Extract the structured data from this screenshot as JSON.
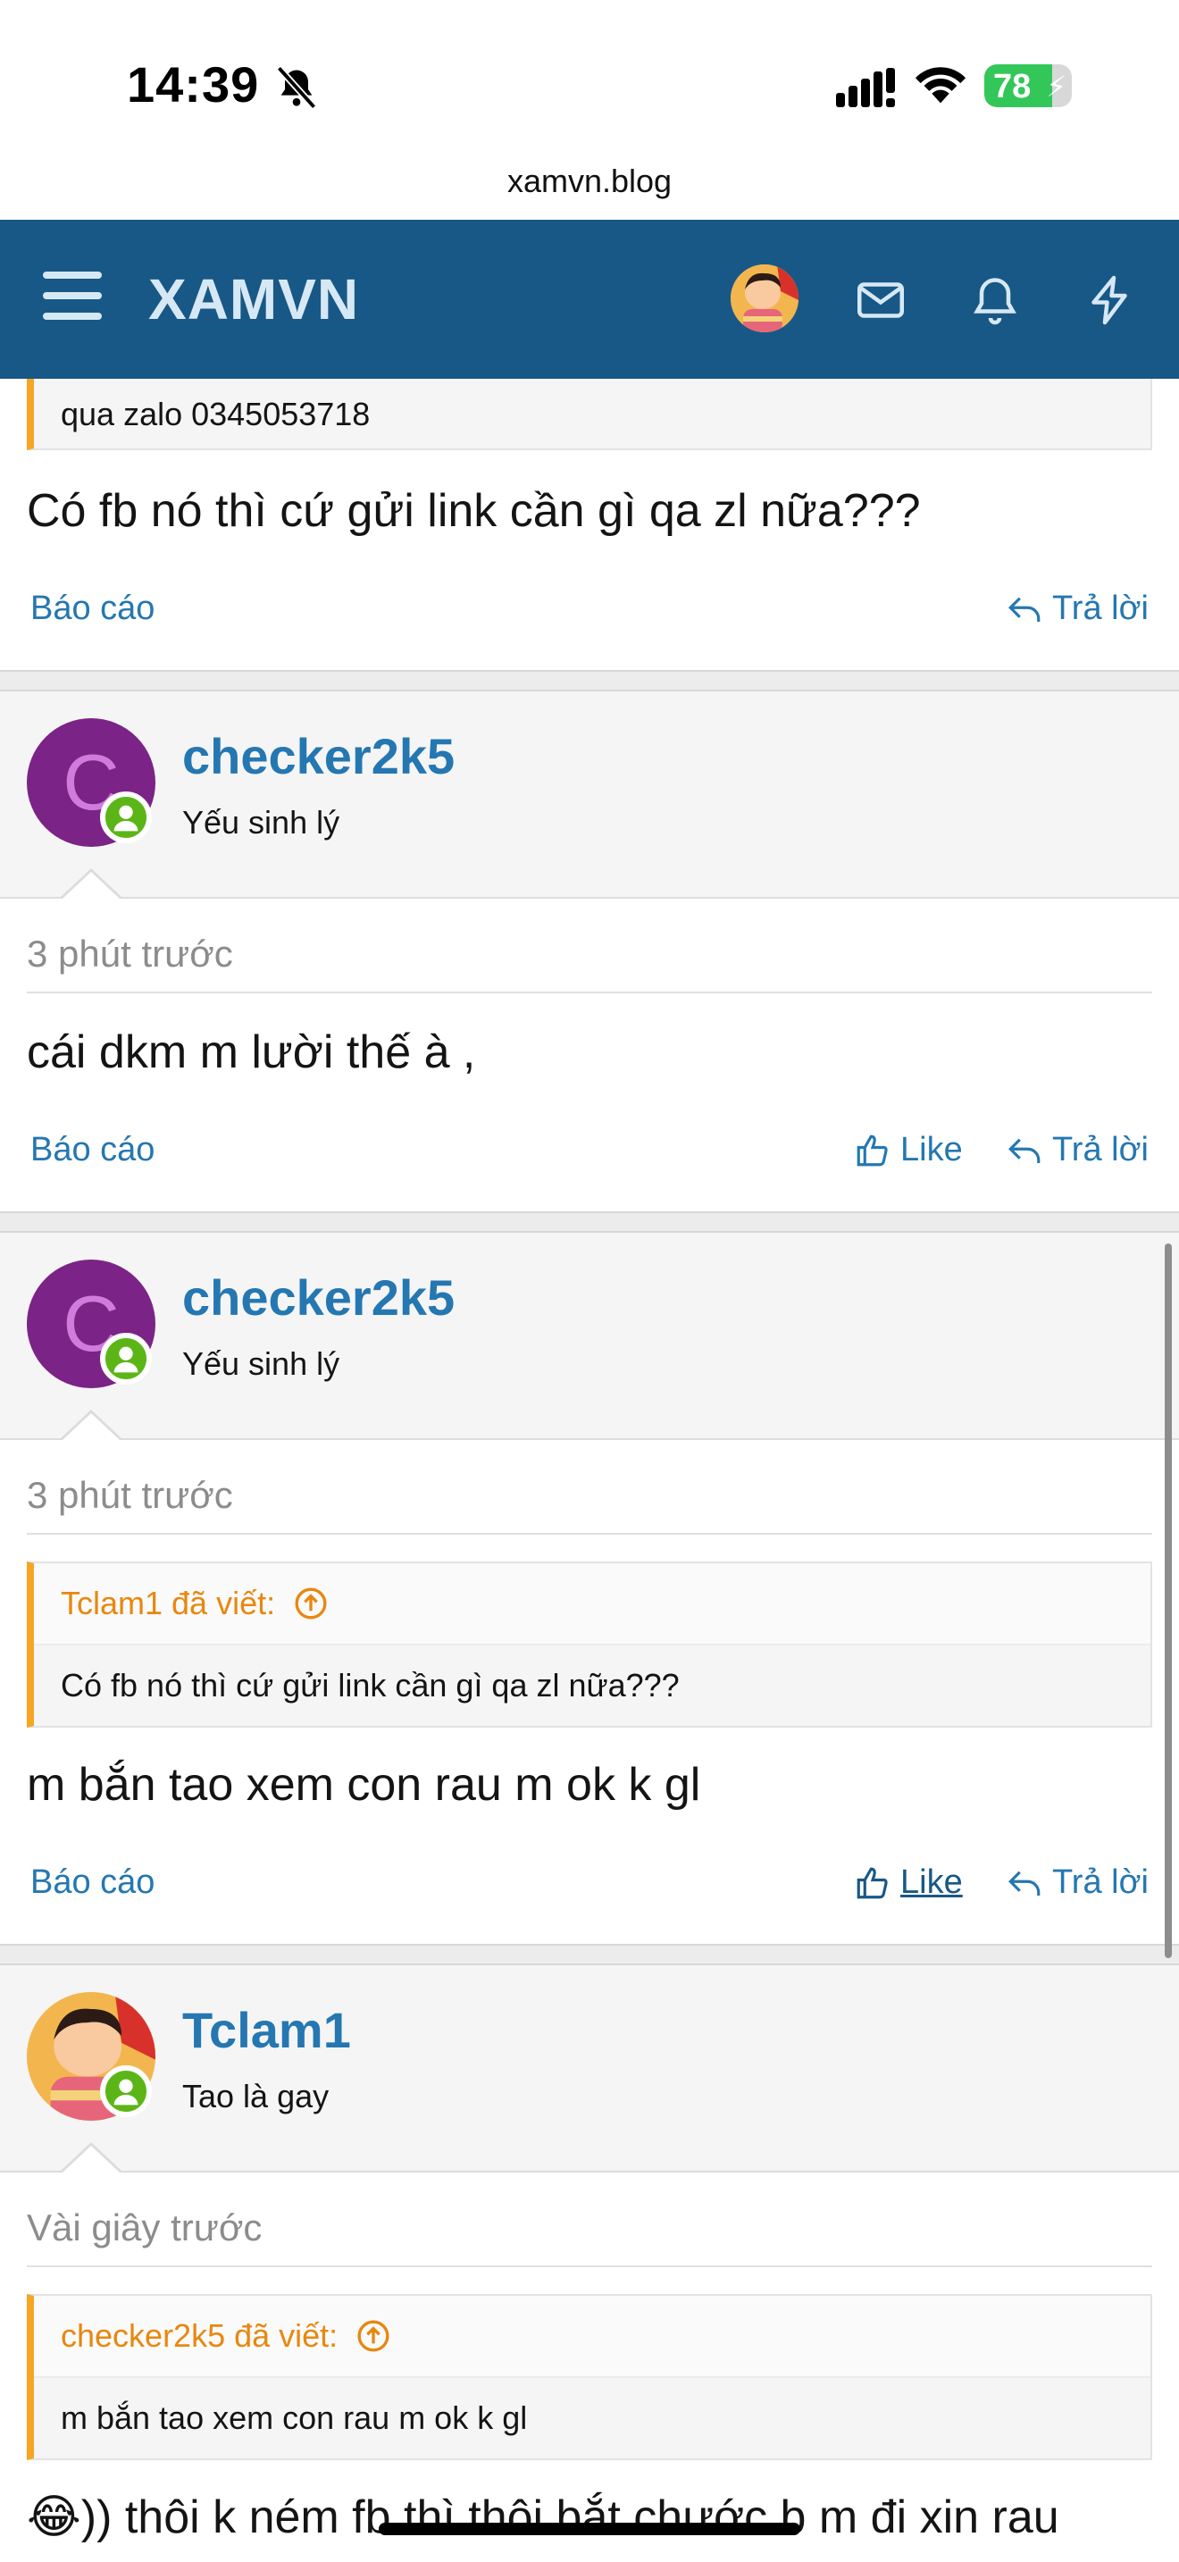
{
  "status_bar": {
    "time": "14:39",
    "battery": "78",
    "battery_level": 0.78,
    "url": "xamvn.blog"
  },
  "nav": {
    "logo": "XAMVN",
    "icons": [
      "menu-icon",
      "user-avatar",
      "envelope-icon",
      "bell-icon",
      "bolt-icon"
    ]
  },
  "posts": [
    {
      "quote_body": "qua zalo 0345053718",
      "text": "Có fb nó thì cứ gửi link cần gì qa zl nữa???",
      "report": "Báo cáo",
      "reply": "Trả lời"
    },
    {
      "username": "checker2k5",
      "user_title": "Yếu sinh lý",
      "avatar_letter": "C",
      "time": "3 phút trước",
      "text": "cái dkm m lười thế à ,",
      "report": "Báo cáo",
      "like": "Like",
      "reply": "Trả lời"
    },
    {
      "username": "checker2k5",
      "user_title": "Yếu sinh lý",
      "avatar_letter": "C",
      "time": "3 phút trước",
      "quote_author": "Tclam1 đã viết:",
      "quote_body": "Có fb nó thì cứ gửi link cần gì qa zl nữa???",
      "text": "m bắn tao xem con rau m ok k gl",
      "report": "Báo cáo",
      "like": "Like",
      "reply": "Trả lời"
    },
    {
      "username": "Tclam1",
      "user_title": "Tao là gay",
      "time": "Vài giây trước",
      "quote_author": "checker2k5 đã viết:",
      "quote_body": "m bắn tao xem con rau m ok k gl",
      "text": "😂)) thôi k ném fb thì thôi bắt chước b m đi xin rau"
    }
  ],
  "colors": {
    "navbar": "#185886",
    "link": "#2577b1",
    "quote_accent": "#f5a623",
    "online": "#5cb517",
    "avatar_purple": "#7b2386"
  }
}
